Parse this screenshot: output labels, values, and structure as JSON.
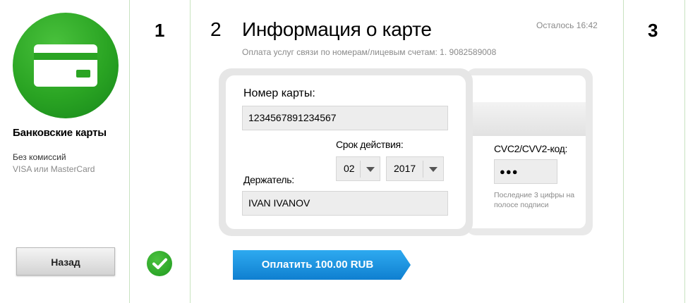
{
  "payment_method": {
    "title": "Банковские карты",
    "fee_note": "Без комиссий",
    "networks": "VISA или MasterCard",
    "icon": "bank-card-icon",
    "accent_color": "#2aa423"
  },
  "nav": {
    "back_label": "Назад"
  },
  "steps": {
    "step1": "1",
    "step2": "2",
    "step3": "3",
    "step1_status_icon": "check-icon"
  },
  "header": {
    "title": "Информация о карте",
    "timer": "Осталось 16:42",
    "subtitle": "Оплата услуг связи по номерам/лицевым счетам: 1. 9082589008"
  },
  "card_form": {
    "card_number_label": "Номер карты:",
    "card_number_value": "1234567891234567",
    "expiry_label": "Срок действия:",
    "expiry_month": "02",
    "expiry_year": "2017",
    "holder_label": "Держатель:",
    "holder_value": "IVAN IVANOV",
    "cvc_label": "CVC2/CVV2-код:",
    "cvc_value": "●●●",
    "cvc_hint": "Последние 3 цифры на полосе подписи"
  },
  "pay_button": {
    "label": "Оплатить 100.00 RUB",
    "color": "#1a8fdc"
  }
}
